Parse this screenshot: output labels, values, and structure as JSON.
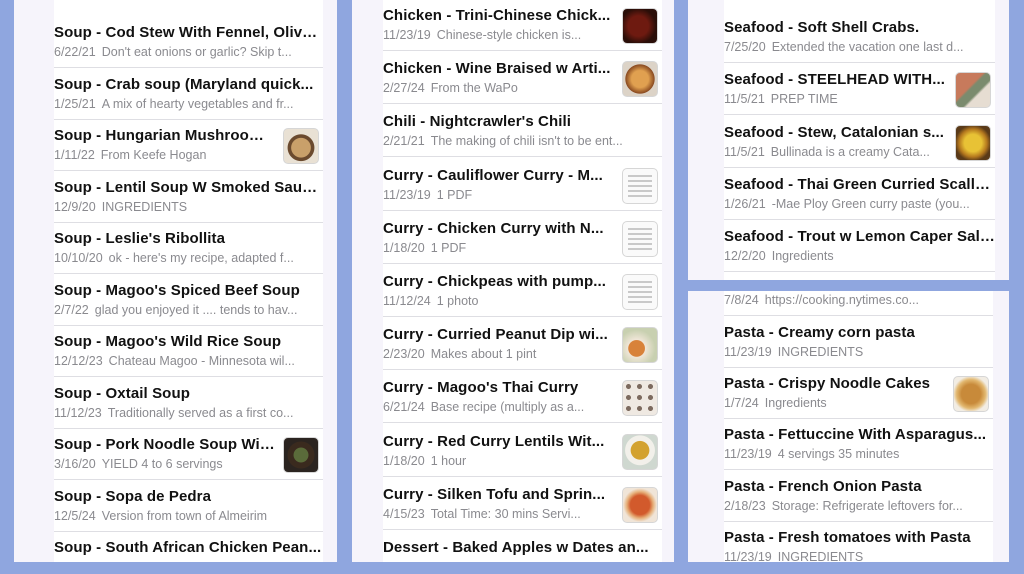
{
  "panels": {
    "soup": [
      {
        "title": "Soup - Cod Stew With Fennel, Olive...",
        "date": "6/22/21",
        "preview": "Don't eat onions or garlic? Skip t...",
        "thumb": null
      },
      {
        "title": "Soup - Crab soup (Maryland quick...",
        "date": "1/25/21",
        "preview": "A mix of hearty vegetables and fr...",
        "thumb": null
      },
      {
        "title": "Soup - Hungarian Mushroom...",
        "date": "1/11/22",
        "preview": "From Keefe Hogan",
        "thumb": "bowl-soup-photo"
      },
      {
        "title": "Soup - Lentil Soup W Smoked Saus...",
        "date": "12/9/20",
        "preview": "INGREDIENTS",
        "thumb": null
      },
      {
        "title": "Soup - Leslie's Ribollita",
        "date": "10/10/20",
        "preview": "ok - here's my recipe, adapted f...",
        "thumb": null
      },
      {
        "title": "Soup - Magoo's Spiced Beef Soup",
        "date": "2/7/22",
        "preview": "glad you enjoyed it .... tends to hav...",
        "thumb": null
      },
      {
        "title": "Soup - Magoo's Wild Rice Soup",
        "date": "12/12/23",
        "preview": "Chateau Magoo - Minnesota wil...",
        "thumb": null
      },
      {
        "title": "Soup - Oxtail Soup",
        "date": "11/12/23",
        "preview": "Traditionally served as a first co...",
        "thumb": null
      },
      {
        "title": "Soup - Pork Noodle Soup Wit...",
        "date": "3/16/20",
        "preview": "YIELD 4 to 6 servings",
        "thumb": "noodle-soup-photo"
      },
      {
        "title": "Soup - Sopa de Pedra",
        "date": "12/5/24",
        "preview": "Version from town of Almeirim",
        "thumb": null
      },
      {
        "title": "Soup - South African Chicken Pean...",
        "date": "",
        "preview": "",
        "thumb": null
      }
    ],
    "chicken": [
      {
        "title": "Chicken - Trini-Chinese Chick...",
        "date": "11/23/19",
        "preview": "Chinese-style chicken is...",
        "thumb": "chicken-photo"
      },
      {
        "title": "Chicken - Wine Braised w Arti...",
        "date": "2/27/24",
        "preview": "From the WaPo",
        "thumb": "braised-chicken-photo"
      },
      {
        "title": "Chili - Nightcrawler's Chili",
        "date": "2/21/21",
        "preview": "The making of chili isn't to be ent...",
        "thumb": null
      },
      {
        "title": "Curry - Cauliflower Curry - M...",
        "date": "11/23/19",
        "preview": "1 PDF",
        "thumb": "pdf-doc"
      },
      {
        "title": "Curry - Chicken Curry with N...",
        "date": "1/18/20",
        "preview": "1 PDF",
        "thumb": "pdf-doc"
      },
      {
        "title": "Curry - Chickpeas with pump...",
        "date": "11/12/24",
        "preview": "1 photo",
        "thumb": "pdf-doc"
      },
      {
        "title": "Curry - Curried Peanut Dip wi...",
        "date": "2/23/20",
        "preview": "Makes about 1 pint",
        "thumb": "dip-photo"
      },
      {
        "title": "Curry - Magoo's Thai Curry",
        "date": "6/21/24",
        "preview": "Base recipe (multiply as a...",
        "thumb": "curry-grid-photo"
      },
      {
        "title": "Curry - Red Curry Lentils Wit...",
        "date": "1/18/20",
        "preview": "1 hour",
        "thumb": "lentils-photo"
      },
      {
        "title": "Curry - Silken Tofu and Sprin...",
        "date": "4/15/23",
        "preview": "Total Time: 30 mins Servi...",
        "thumb": "tofu-photo"
      },
      {
        "title": "Dessert - Baked Apples w Dates an...",
        "date": "",
        "preview": "",
        "thumb": null
      }
    ],
    "seafood": [
      {
        "title": "Seafood - Soft Shell Crabs.",
        "date": "7/25/20",
        "preview": "Extended the vacation one last d...",
        "thumb": null
      },
      {
        "title": "Seafood - STEELHEAD WITH...",
        "date": "11/5/21",
        "preview": "PREP TIME",
        "thumb": "steelhead-photo"
      },
      {
        "title": "Seafood - Stew, Catalonian s...",
        "date": "11/5/21",
        "preview": "Bullinada is a creamy Cata...",
        "thumb": "stew-photo"
      },
      {
        "title": "Seafood - Thai Green Curried Scallo...",
        "date": "1/26/21",
        "preview": "-Mae Ploy Green curry paste (you...",
        "thumb": null
      },
      {
        "title": "Seafood - Trout w Lemon Caper Salsa",
        "date": "12/2/20",
        "preview": "Ingredients",
        "thumb": null
      }
    ],
    "pasta_top_partial": {
      "date": "7/8/24",
      "preview": "https://cooking.nytimes.co..."
    },
    "pasta": [
      {
        "title": "Pasta - Creamy corn pasta",
        "date": "11/23/19",
        "preview": "INGREDIENTS",
        "thumb": null
      },
      {
        "title": "Pasta - Crispy Noodle Cakes",
        "date": "1/7/24",
        "preview": "Ingredients",
        "thumb": "noodle-cake-photo"
      },
      {
        "title": "Pasta - Fettuccine With Asparagus...",
        "date": "11/23/19",
        "preview": "4 servings 35 minutes",
        "thumb": null
      },
      {
        "title": "Pasta - French Onion Pasta",
        "date": "2/18/23",
        "preview": "Storage: Refrigerate leftovers for...",
        "thumb": null
      },
      {
        "title": "Pasta - Fresh tomatoes with Pasta",
        "date": "11/23/19",
        "preview": "INGREDIENTS",
        "thumb": null
      }
    ]
  }
}
